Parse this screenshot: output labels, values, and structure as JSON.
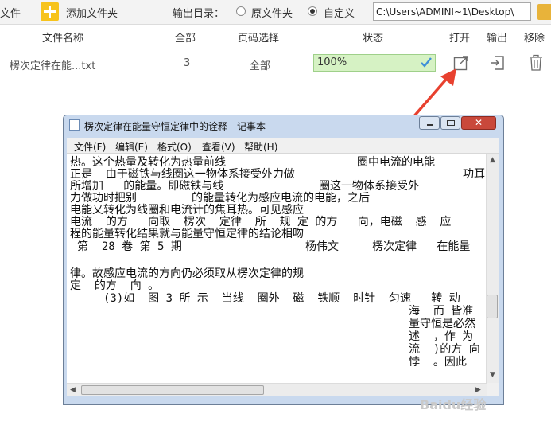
{
  "toolbar": {
    "file_label": "文件",
    "add_folder_label": "添加文件夹",
    "output_dir_label": "输出目录：",
    "radio_original": "原文件夹",
    "radio_custom": "自定义",
    "output_path": "C:\\Users\\ADMINI~1\\Desktop\\"
  },
  "table": {
    "headers": [
      "文件名称",
      "全部",
      "页码选择",
      "状态",
      "打开",
      "输出",
      "移除"
    ],
    "row": {
      "filename": "楞次定律在能...txt",
      "pages": "3",
      "page_selection": "全部",
      "status": "100%",
      "status_percent": 100
    }
  },
  "notepad": {
    "title": "楞次定律在能量守恒定律中的诠释 - 记事本",
    "menus": [
      "文件(F)",
      "编辑(E)",
      "格式(O)",
      "查看(V)",
      "帮助(H)"
    ],
    "lines": [
      "热。这个热量及转化为热量前线",
      "圈中电流的电能",
      "正是  由于磁铁与线圈这一物体系接受外力做",
      "功耳",
      "所增加   的能量。即磁铁与线",
      "圈这一物体系接受外",
      "力做功时把别",
      "的能量转化为感应电流的电能，之后",
      "电能又转化为线圈和电流计的焦耳热。可见感应",
      "电流  的方   向取  楞次  定律  所  规 定 的方   向，电磁  感  应",
      "程的能量转化结果就与能量守恒定律的结论相吻",
      "第  28 卷 第 5 期",
      "杨伟文     楞次定律   在能量",
      "律。故感应电流的方向仍必须取从楞次定律的规",
      "定  的方  向 。",
      "(3)如  图 3 所 示  当线  圈外  磁  铁顺  时针  匀速   转 动",
      "海  而 皆准",
      "量守恒是必然",
      "述  ，作 为",
      "流  )的方 向",
      "悖  。因此"
    ]
  },
  "watermark": "Baidu经验",
  "colors": {
    "status_fill": "#d6f2c4",
    "add_icon": "#f7c31b",
    "annotation_arrow": "#e8412f"
  }
}
